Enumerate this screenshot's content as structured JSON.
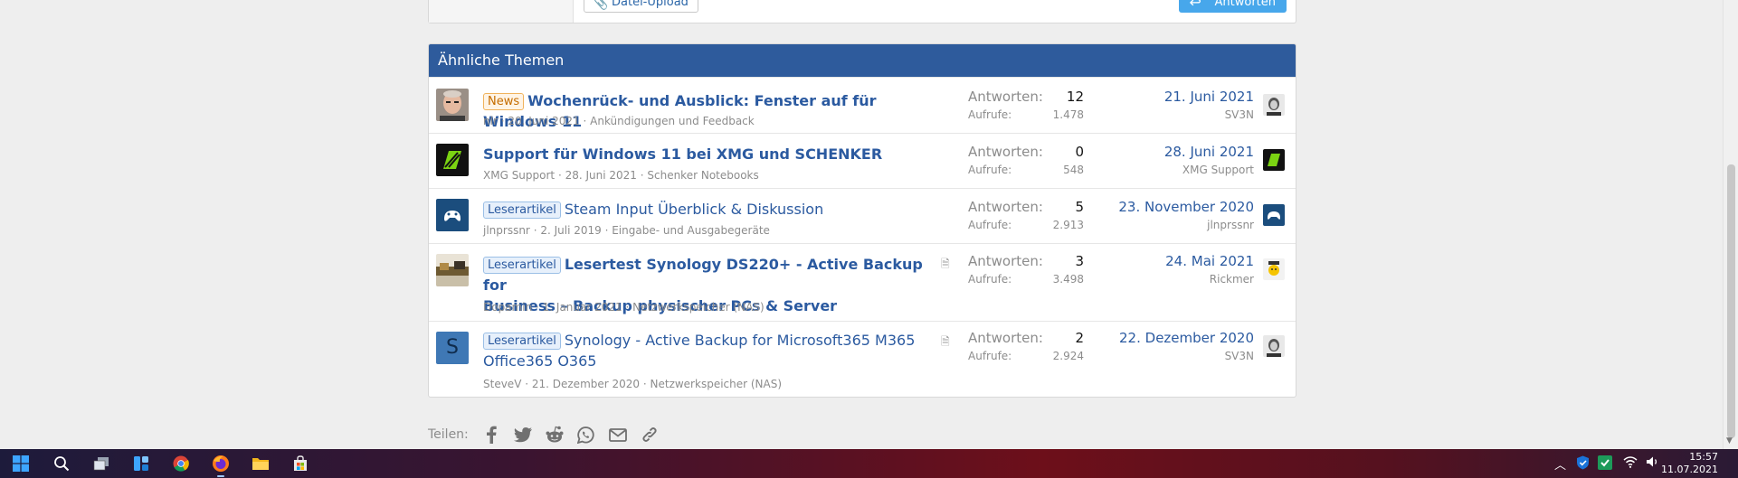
{
  "editor": {
    "upload_label": "Datei-Upload",
    "reply_label": "Antworten"
  },
  "similar": {
    "title": "Ähnliche Themen",
    "replies_label": "Antworten:",
    "views_label": "Aufrufe:",
    "threads": [
      {
        "label": "News",
        "title": "Wochenrück- und Ausblick: Fenster auf für Windows 11",
        "author": "nlr",
        "date": "20. Juni 2021",
        "forum": "Ankündigungen und Feedback",
        "replies": "12",
        "views": "1.478",
        "last_date": "21. Juni 2021",
        "last_user": "SV3N"
      },
      {
        "label": "",
        "title": "Support für Windows 11 bei XMG und SCHENKER",
        "author": "XMG Support",
        "date": "28. Juni 2021",
        "forum": "Schenker Notebooks",
        "replies": "0",
        "views": "548",
        "last_date": "28. Juni 2021",
        "last_user": "XMG Support"
      },
      {
        "label": "Leserartikel",
        "title": "Steam Input Überblick & Diskussion",
        "author": "jlnprssnr",
        "date": "2. Juli 2019",
        "forum": "Eingabe- und Ausgabegeräte",
        "replies": "5",
        "views": "2.913",
        "last_date": "23. November 2020",
        "last_user": "jlnprssnr"
      },
      {
        "label": "Leserartikel",
        "title_line1": "Lesertest Synology DS220+ - Active Backup for",
        "title_line2": "Business – Backup physischer PCs & Server",
        "author": "Dopamin",
        "date": "1. Januar 2021",
        "forum": "Netzwerkspeicher (NAS)",
        "replies": "3",
        "views": "3.498",
        "last_date": "24. Mai 2021",
        "last_user": "Rickmer"
      },
      {
        "label": "Leserartikel",
        "title_line1": "Synology - Active Backup for Microsoft365 M365",
        "title_line2": "Office365 O365",
        "avatar_letter": "S",
        "author": "SteveV",
        "date": "21. Dezember 2020",
        "forum": "Netzwerkspeicher (NAS)",
        "replies": "2",
        "views": "2.924",
        "last_date": "22. Dezember 2020",
        "last_user": "SV3N"
      }
    ]
  },
  "share": {
    "label": "Teilen:"
  },
  "taskbar": {
    "time": "15:57",
    "date": "11.07.2021"
  },
  "colors": {
    "header": "#2e5b9c",
    "link": "#2b5aa0",
    "accent": "#47a7eb"
  }
}
